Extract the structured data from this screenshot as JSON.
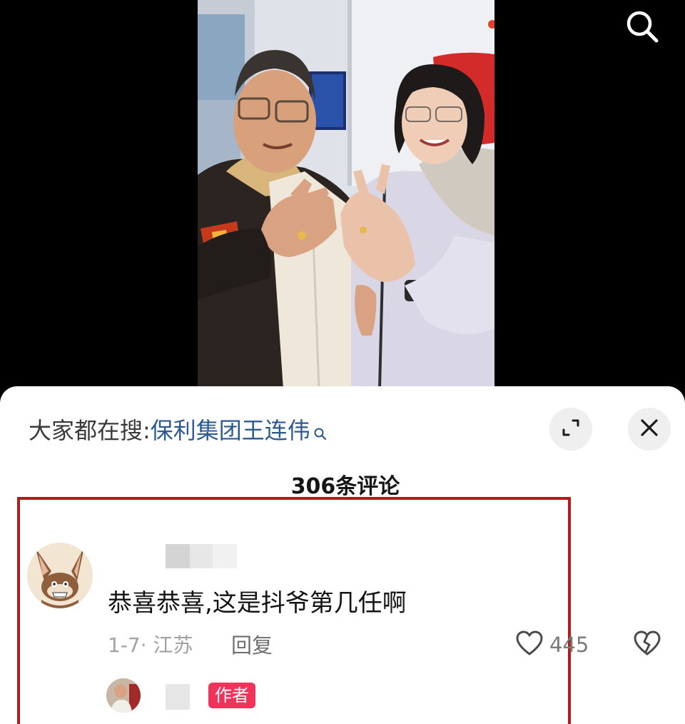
{
  "hot_search": {
    "prefix": "大家都在搜:",
    "term": "保利集团王连伟"
  },
  "comments": {
    "count_label": "306条评论",
    "items": [
      {
        "text": "恭喜恭喜,这是抖爷第几任啊",
        "meta": "1-7· 江苏",
        "reply_label": "回复",
        "likes": "445"
      }
    ],
    "author_badge": "作者"
  },
  "icons": {
    "search": "search-icon",
    "expand": "expand-icon",
    "close": "close-icon",
    "like": "heart-outline-icon",
    "dislike": "broken-heart-icon"
  },
  "colors": {
    "link": "#2b5a92",
    "badge": "#f0335a",
    "highlight_border": "#b01b1b"
  }
}
